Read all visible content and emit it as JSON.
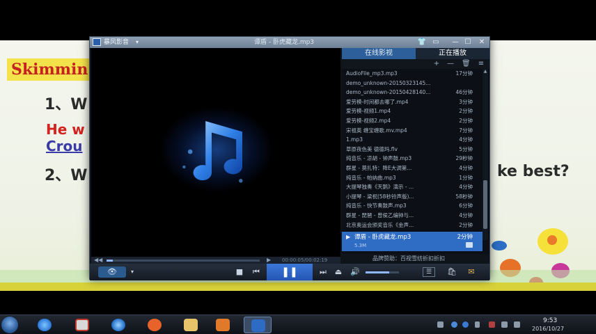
{
  "slide": {
    "title": "Skimmin",
    "q1": "1、W",
    "answer_line1": "He w",
    "answer_line2": "Crou",
    "q2": "2、W",
    "q2_tail": "ke best?"
  },
  "player": {
    "app_name": "暴风影音",
    "app_caret": "▾",
    "track_title": "谭盾 - 卧虎藏龙.mp3",
    "window_buttons": {
      "skin": "👕",
      "mini": "▭",
      "min": "—",
      "max": "☐",
      "close": "✕"
    },
    "tabs": {
      "online": "在线影视",
      "playing": "正在播放"
    },
    "tools": {
      "add": "+",
      "remove": "—",
      "delete": "🗑",
      "sort": "≡"
    },
    "playlist": [
      {
        "name": "AudioFile_mp3.mp3",
        "duration": "17分钟"
      },
      {
        "name": "demo_unknown-20150323145...",
        "duration": ""
      },
      {
        "name": "demo_unknown-20150428140...",
        "duration": "46分钟"
      },
      {
        "name": "爱劳模-时间都去哪了.mp4",
        "duration": "3分钟"
      },
      {
        "name": "爱劳模-视频1.mp4",
        "duration": "2分钟"
      },
      {
        "name": "爱劳模-视频2.mp4",
        "duration": "2分钟"
      },
      {
        "name": "宋祖英 缠宝缠歌.mv.mp4",
        "duration": "7分钟"
      },
      {
        "name": "1.mp3",
        "duration": "4分钟"
      },
      {
        "name": "草原夜色美 德德玛.flv",
        "duration": "5分钟"
      },
      {
        "name": "纯音乐 - 凉胡 - 钟声鼓.mp3",
        "duration": "29秒钟"
      },
      {
        "name": "群星 - 莫扎特：降E大调第...",
        "duration": "4分钟"
      },
      {
        "name": "纯音乐 - 帕纳曲.mp3",
        "duration": "1分钟"
      },
      {
        "name": "大提琴独奏《天鹅》演示 - ...",
        "duration": "4分钟"
      },
      {
        "name": "小提琴 - 梁祝(58秒铃声版)...",
        "duration": "58秒钟"
      },
      {
        "name": "纯音乐 - 快节奏鼓声.mp3",
        "duration": "6分钟"
      },
      {
        "name": "群星 - 琵琶 - 曾侯乙编钟与...",
        "duration": "4分钟"
      },
      {
        "name": "北京奥运会颁奖音乐《金声...",
        "duration": "2分钟"
      }
    ],
    "now_playing": {
      "arrow": "▶",
      "title": "谭盾 - 卧虎藏龙.mp3",
      "duration": "2分钟",
      "size": "5.3M"
    },
    "footer": "品牌赞助：百视雪纺折扣折扣",
    "seek": {
      "start": "◀◀",
      "end": "▶",
      "time": "00:00:05/00:02:19",
      "progress": 0.04
    },
    "controls": {
      "eye": "👁",
      "eye_caret": "▾",
      "stop": "■",
      "prev": "⏮",
      "play_pause": "❚❚",
      "next": "⏭",
      "eject": "⏏",
      "volume_icon": "🔊",
      "volume_level": 0.7,
      "list": "☰",
      "bag": "🛍",
      "mail": "✉"
    }
  },
  "taskbar": {
    "clock_time": "9:53",
    "clock_date": "2016/10/27"
  }
}
